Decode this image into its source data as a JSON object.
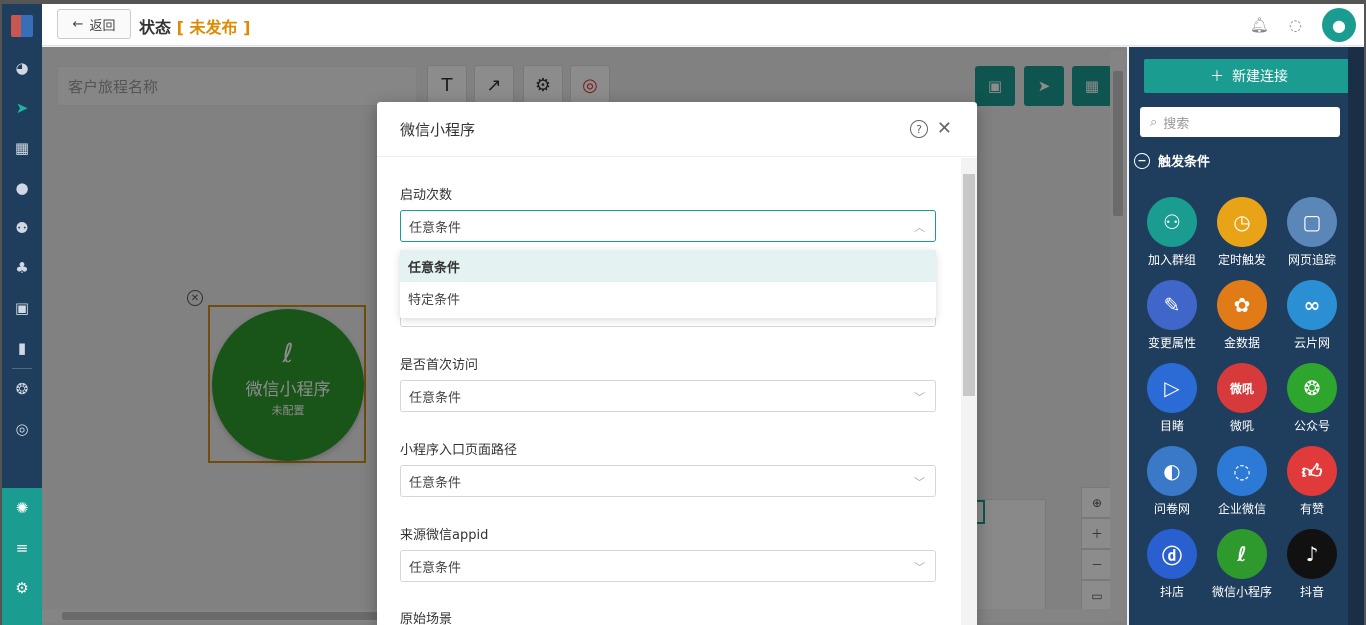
{
  "header": {
    "back_label": "返回",
    "title_prefix": "状态",
    "status": "未发布"
  },
  "canvas": {
    "journey_name_placeholder": "客户旅程名称",
    "node": {
      "title": "微信小程序",
      "subtitle": "未配置"
    }
  },
  "right_panel": {
    "new_connection": "新建连接",
    "search_placeholder": "搜索",
    "section_title": "触发条件",
    "items": [
      {
        "label": "加入群组",
        "color": "#1a9c90",
        "icon": "user-add-icon"
      },
      {
        "label": "定时触发",
        "color": "#e8a317",
        "icon": "clock-icon"
      },
      {
        "label": "网页追踪",
        "color": "#5a86b8",
        "icon": "web-track-icon"
      },
      {
        "label": "变更属性",
        "color": "#3f66c8",
        "icon": "edit-icon"
      },
      {
        "label": "金数据",
        "color": "#e07b17",
        "icon": "jinshuju-icon"
      },
      {
        "label": "云片网",
        "color": "#2b8fd4",
        "icon": "yunpian-icon"
      },
      {
        "label": "目睹",
        "color": "#2a6bd6",
        "icon": "play-icon"
      },
      {
        "label": "微吼",
        "color": "#d63a3a",
        "icon": "vhall-icon"
      },
      {
        "label": "公众号",
        "color": "#2ea62e",
        "icon": "wechat-icon"
      },
      {
        "label": "问卷网",
        "color": "#3a78c8",
        "icon": "wenjuan-icon"
      },
      {
        "label": "企业微信",
        "color": "#2c7ad6",
        "icon": "wecom-icon"
      },
      {
        "label": "有赞",
        "color": "#e03a3a",
        "icon": "thumb-icon"
      },
      {
        "label": "抖店",
        "color": "#2a5fd0",
        "icon": "doudian-icon"
      },
      {
        "label": "微信小程序",
        "color": "#2e9a2e",
        "icon": "miniprogram-icon"
      },
      {
        "label": "抖音",
        "color": "#111111",
        "icon": "douyin-icon"
      }
    ]
  },
  "modal": {
    "title": "微信小程序",
    "fields": [
      {
        "label": "启动次数",
        "value": "任意条件"
      },
      {
        "label": "是否首次访问",
        "value": "任意条件"
      },
      {
        "label": "小程序入口页面路径",
        "value": "任意条件"
      },
      {
        "label": "来源微信appid",
        "value": "任意条件"
      },
      {
        "label": "原始场景",
        "value": ""
      }
    ],
    "dropdown_options": [
      "任意条件",
      "特定条件"
    ]
  }
}
